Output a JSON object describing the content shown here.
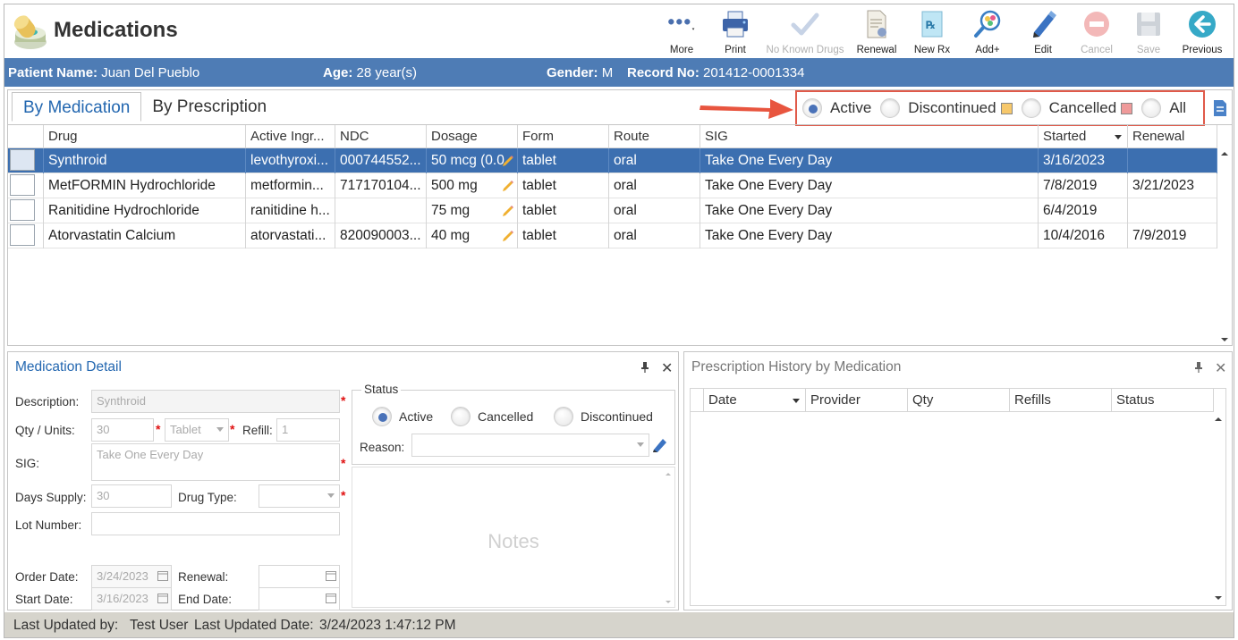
{
  "header": {
    "title": "Medications",
    "toolbar": [
      {
        "label": "More",
        "icon": "more-dots-icon",
        "disabled": false
      },
      {
        "label": "Print",
        "icon": "printer-icon",
        "disabled": false
      },
      {
        "label": "No Known Drugs",
        "icon": "checkmark-icon",
        "disabled": true
      },
      {
        "label": "Renewal",
        "icon": "renewal-document-icon",
        "disabled": false
      },
      {
        "label": "New Rx",
        "icon": "new-rx-icon",
        "disabled": false
      },
      {
        "label": "Add+",
        "icon": "add-search-icon",
        "disabled": false
      },
      {
        "label": "Edit",
        "icon": "pencil-icon",
        "disabled": false
      },
      {
        "label": "Cancel",
        "icon": "cancel-icon",
        "disabled": true
      },
      {
        "label": "Save",
        "icon": "save-floppy-icon",
        "disabled": true
      },
      {
        "label": "Previous",
        "icon": "back-arrow-icon",
        "disabled": false
      }
    ]
  },
  "patient": {
    "name_label": "Patient Name:",
    "name": "Juan Del Pueblo",
    "age_label": "Age:",
    "age": "28 year(s)",
    "gender_label": "Gender:",
    "gender": "M",
    "record_label": "Record No:",
    "record": "201412-0001334"
  },
  "tabs": [
    {
      "label": "By Medication",
      "active": true
    },
    {
      "label": "By Prescription",
      "active": false
    }
  ],
  "filters": {
    "active": "Active",
    "discontinued": "Discontinued",
    "cancelled": "Cancelled",
    "all": "All",
    "selected": "active"
  },
  "colors": {
    "accent": "#2367b0",
    "patient_bar": "#4e7cb5",
    "selected_row": "#3c6fb0",
    "discontinued_legend": "#f7c86b",
    "cancelled_legend": "#ef9a9a",
    "highlight_box": "#e05a4a"
  },
  "grid": {
    "columns": [
      "Drug",
      "Active Ingr...",
      "NDC",
      "Dosage",
      "Form",
      "Route",
      "SIG",
      "Started",
      "Renewal"
    ],
    "rows": [
      {
        "drug": "Synthroid",
        "ingr": "levothyroxi...",
        "ndc": "000744552...",
        "dosage": "50 mcg (0.0",
        "form": "tablet",
        "route": "oral",
        "sig": "Take One Every Day",
        "started": "3/16/2023",
        "renewal": "",
        "selected": true
      },
      {
        "drug": "MetFORMIN Hydrochloride",
        "ingr": "metformin...",
        "ndc": "717170104...",
        "dosage": "500 mg",
        "form": "tablet",
        "route": "oral",
        "sig": "Take One Every Day",
        "started": "7/8/2019",
        "renewal": "3/21/2023",
        "selected": false
      },
      {
        "drug": "Ranitidine Hydrochloride",
        "ingr": "ranitidine h...",
        "ndc": "",
        "dosage": "75 mg",
        "form": "tablet",
        "route": "oral",
        "sig": "Take One Every Day",
        "started": "6/4/2019",
        "renewal": "",
        "selected": false
      },
      {
        "drug": "Atorvastatin Calcium",
        "ingr": "atorvastati...",
        "ndc": "820090003...",
        "dosage": "40 mg",
        "form": "tablet",
        "route": "oral",
        "sig": "Take One Every Day",
        "started": "10/4/2016",
        "renewal": "7/9/2019",
        "selected": false
      }
    ]
  },
  "detail": {
    "title": "Medication Detail",
    "description_label": "Description:",
    "description": "Synthroid",
    "qty_label": "Qty / Units:",
    "qty": "30",
    "units": "Tablet",
    "refill_label": "Refill:",
    "refill": "1",
    "sig_label": "SIG:",
    "sig": "Take One Every Day",
    "days_supply_label": "Days Supply:",
    "days_supply": "30",
    "drug_type_label": "Drug Type:",
    "drug_type": "",
    "lot_label": "Lot Number:",
    "lot": "",
    "order_date_label": "Order Date:",
    "order_date": "3/24/2023",
    "renewal_label": "Renewal:",
    "renewal": "",
    "start_date_label": "Start Date:",
    "start_date": "3/16/2023",
    "end_date_label": "End Date:",
    "end_date": "",
    "status_legend": "Status",
    "status_active": "Active",
    "status_cancelled": "Cancelled",
    "status_discontinued": "Discontinued",
    "reason_label": "Reason:",
    "reason": "",
    "notes_placeholder": "Notes"
  },
  "history": {
    "title": "Prescription History by Medication",
    "columns": [
      "Date",
      "Provider",
      "Qty",
      "Refills",
      "Status"
    ]
  },
  "footer": {
    "updated_by_label": "Last Updated by:",
    "updated_by": "Test User",
    "updated_date_label": "Last Updated Date:",
    "updated_date": "3/24/2023 1:47:12 PM"
  }
}
